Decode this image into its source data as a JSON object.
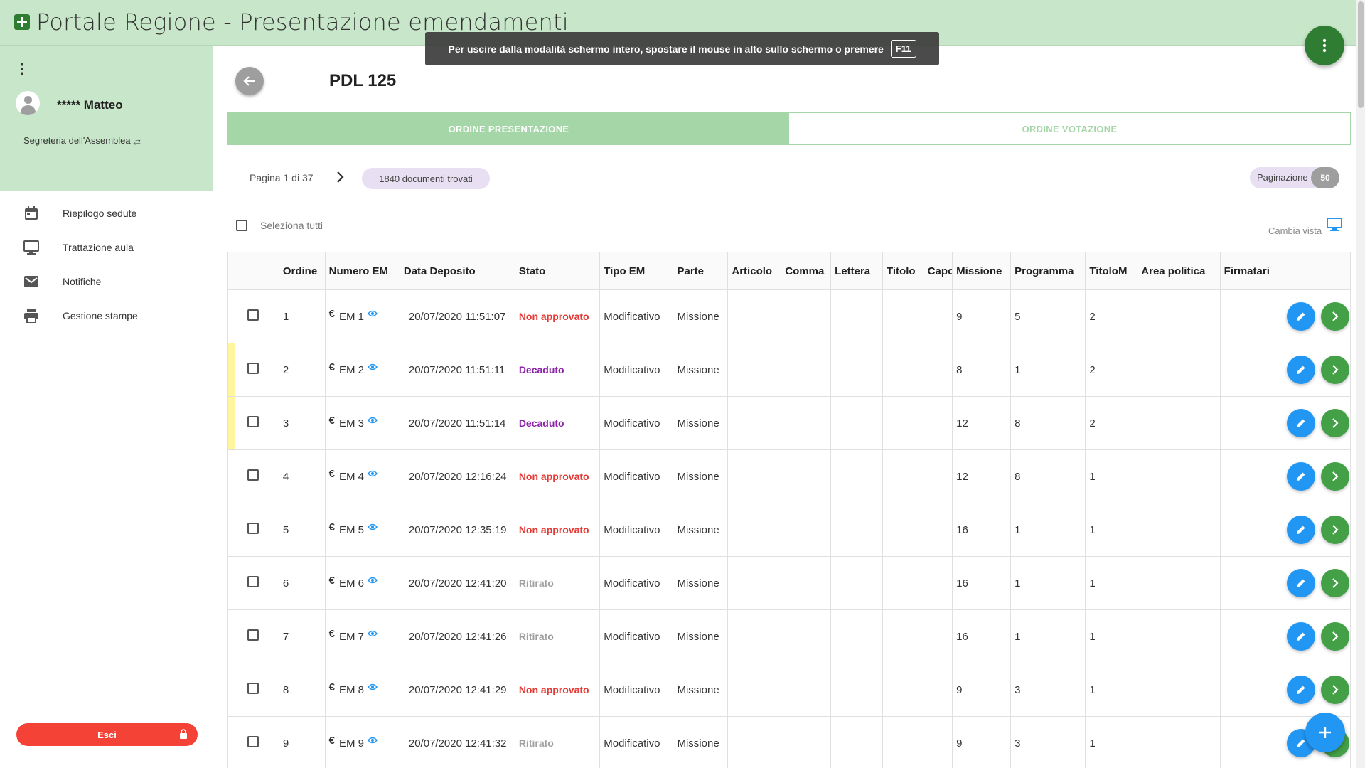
{
  "app": {
    "title": "Portale Regione - Presentazione emendamenti"
  },
  "toast": {
    "message": "Per uscire dalla modalità schermo intero, spostare il mouse in alto sullo schermo o premere",
    "key": "F11"
  },
  "user": {
    "name": "***** Matteo",
    "role": "Segreteria dell'Assemblea ⥄"
  },
  "sidebar": {
    "items": [
      {
        "label": "Riepilogo sedute",
        "icon": "calendar-icon"
      },
      {
        "label": "Trattazione aula",
        "icon": "monitor-icon"
      },
      {
        "label": "Notifiche",
        "icon": "mail-icon"
      },
      {
        "label": "Gestione stampe",
        "icon": "printer-icon"
      }
    ],
    "exit_label": "Esci"
  },
  "page": {
    "title": "PDL 125"
  },
  "tabs": [
    {
      "label": "ORDINE PRESENTAZIONE",
      "active": true
    },
    {
      "label": "ORDINE VOTAZIONE",
      "active": false
    }
  ],
  "pager": {
    "text": "Pagina 1 di 37",
    "documents": "1840 documenti trovati",
    "pagination_label": "Paginazione",
    "pagination_value": "50"
  },
  "select_all_label": "Seleziona tutti",
  "change_view_label": "Cambia vista",
  "colors": {
    "accent": "#2e7d32",
    "light_green": "#c8e6c9",
    "tab_green": "#a5d6a7",
    "non_approvato": "#e53935",
    "decaduto": "#8e24aa",
    "ritirato": "#9e9e9e",
    "stripe": "#fff59d",
    "edit": "#2196f3",
    "go": "#43a047"
  },
  "table": {
    "columns": [
      "Ordine",
      "Numero EM",
      "Data Deposito",
      "Stato",
      "Tipo EM",
      "Parte",
      "Articolo",
      "Comma",
      "Lettera",
      "Titolo",
      "Capo",
      "Missione",
      "Programma",
      "TitoloM",
      "Area politica",
      "Firmatari"
    ],
    "rows": [
      {
        "ordine": "1",
        "numero": "EM 1",
        "data": "20/07/2020 11:51:07",
        "stato": "Non approvato",
        "tipo": "Modificativo",
        "parte": "Missione",
        "articolo": "",
        "comma": "",
        "lettera": "",
        "titolo": "",
        "capo": "",
        "missione": "9",
        "programma": "5",
        "titolom": "2",
        "area": "",
        "firmatari": "",
        "stripe": false
      },
      {
        "ordine": "2",
        "numero": "EM 2",
        "data": "20/07/2020 11:51:11",
        "stato": "Decaduto",
        "tipo": "Modificativo",
        "parte": "Missione",
        "articolo": "",
        "comma": "",
        "lettera": "",
        "titolo": "",
        "capo": "",
        "missione": "8",
        "programma": "1",
        "titolom": "2",
        "area": "",
        "firmatari": "",
        "stripe": true
      },
      {
        "ordine": "3",
        "numero": "EM 3",
        "data": "20/07/2020 11:51:14",
        "stato": "Decaduto",
        "tipo": "Modificativo",
        "parte": "Missione",
        "articolo": "",
        "comma": "",
        "lettera": "",
        "titolo": "",
        "capo": "",
        "missione": "12",
        "programma": "8",
        "titolom": "2",
        "area": "",
        "firmatari": "",
        "stripe": true
      },
      {
        "ordine": "4",
        "numero": "EM 4",
        "data": "20/07/2020 12:16:24",
        "stato": "Non approvato",
        "tipo": "Modificativo",
        "parte": "Missione",
        "articolo": "",
        "comma": "",
        "lettera": "",
        "titolo": "",
        "capo": "",
        "missione": "12",
        "programma": "8",
        "titolom": "1",
        "area": "",
        "firmatari": "",
        "stripe": false
      },
      {
        "ordine": "5",
        "numero": "EM 5",
        "data": "20/07/2020 12:35:19",
        "stato": "Non approvato",
        "tipo": "Modificativo",
        "parte": "Missione",
        "articolo": "",
        "comma": "",
        "lettera": "",
        "titolo": "",
        "capo": "",
        "missione": "16",
        "programma": "1",
        "titolom": "1",
        "area": "",
        "firmatari": "",
        "stripe": false
      },
      {
        "ordine": "6",
        "numero": "EM 6",
        "data": "20/07/2020 12:41:20",
        "stato": "Ritirato",
        "tipo": "Modificativo",
        "parte": "Missione",
        "articolo": "",
        "comma": "",
        "lettera": "",
        "titolo": "",
        "capo": "",
        "missione": "16",
        "programma": "1",
        "titolom": "1",
        "area": "",
        "firmatari": "",
        "stripe": false
      },
      {
        "ordine": "7",
        "numero": "EM 7",
        "data": "20/07/2020 12:41:26",
        "stato": "Ritirato",
        "tipo": "Modificativo",
        "parte": "Missione",
        "articolo": "",
        "comma": "",
        "lettera": "",
        "titolo": "",
        "capo": "",
        "missione": "16",
        "programma": "1",
        "titolom": "1",
        "area": "",
        "firmatari": "",
        "stripe": false
      },
      {
        "ordine": "8",
        "numero": "EM 8",
        "data": "20/07/2020 12:41:29",
        "stato": "Non approvato",
        "tipo": "Modificativo",
        "parte": "Missione",
        "articolo": "",
        "comma": "",
        "lettera": "",
        "titolo": "",
        "capo": "",
        "missione": "9",
        "programma": "3",
        "titolom": "1",
        "area": "",
        "firmatari": "",
        "stripe": false
      },
      {
        "ordine": "9",
        "numero": "EM 9",
        "data": "20/07/2020 12:41:32",
        "stato": "Ritirato",
        "tipo": "Modificativo",
        "parte": "Missione",
        "articolo": "",
        "comma": "",
        "lettera": "",
        "titolo": "",
        "capo": "",
        "missione": "9",
        "programma": "3",
        "titolom": "1",
        "area": "",
        "firmatari": "",
        "stripe": false
      }
    ]
  }
}
